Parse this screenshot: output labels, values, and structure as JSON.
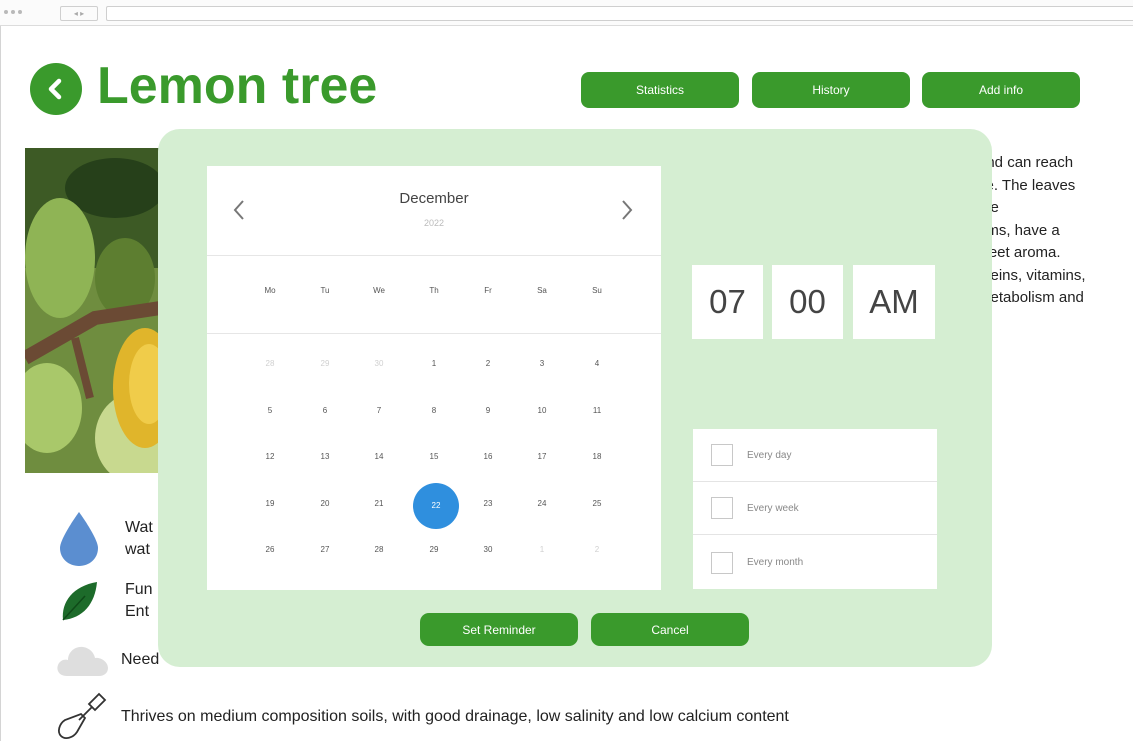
{
  "header": {
    "title": "Lemon tree",
    "buttons": {
      "statistics": "Statistics",
      "history": "History",
      "add_info": "Add info"
    }
  },
  "description": {
    "lines": [
      "and can reach",
      "ce. The leaves",
      "the",
      "oms, have a",
      "weet aroma.",
      "oteins, vitamins,",
      "metabolism and"
    ]
  },
  "care": {
    "water": {
      "line1": "Wat",
      "line2": "wat",
      "icon": "water-drop-icon"
    },
    "fungi": {
      "line1": "Fun",
      "line2": "Ent",
      "icon": "leaf-icon"
    },
    "climate": {
      "line1": "Need",
      "icon": "cloud-icon"
    },
    "soil": {
      "line1": "Thrives on medium composition soils, with good drainage, low salinity and low calcium content",
      "icon": "shovel-icon"
    }
  },
  "reminder": {
    "calendar": {
      "month": "December",
      "year": "2022",
      "weekdays": [
        "Mo",
        "Tu",
        "We",
        "Th",
        "Fr",
        "Sa",
        "Su"
      ],
      "weeks": [
        [
          "28",
          "29",
          "30",
          "1",
          "2",
          "3",
          "4"
        ],
        [
          "5",
          "6",
          "7",
          "8",
          "9",
          "10",
          "11"
        ],
        [
          "12",
          "13",
          "14",
          "15",
          "16",
          "17",
          "18"
        ],
        [
          "19",
          "20",
          "21",
          "22",
          "23",
          "24",
          "25"
        ],
        [
          "26",
          "27",
          "28",
          "29",
          "30",
          "1",
          "2"
        ]
      ],
      "selected_day": "22"
    },
    "time": {
      "hour": "07",
      "minute": "00",
      "period": "AM"
    },
    "repeat": {
      "every_day": "Every day",
      "every_week": "Every week",
      "every_month": "Every month"
    },
    "buttons": {
      "set": "Set Reminder",
      "cancel": "Cancel"
    }
  },
  "colors": {
    "brand_green": "#3a9a2c",
    "modal_bg": "#d5eed2",
    "selected_blue": "#2f8fde"
  }
}
